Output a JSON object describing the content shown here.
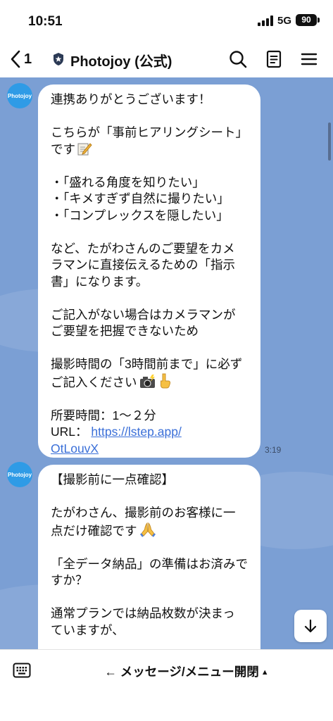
{
  "status_bar": {
    "time": "10:51",
    "network": "5G",
    "battery": "90"
  },
  "nav": {
    "back_count": "1",
    "title": "Photojoy (公式)",
    "icons": [
      "search-icon",
      "note-icon",
      "menu-icon"
    ]
  },
  "messages": [
    {
      "sender": "Photojoy",
      "lines": [
        "連携ありがとうございます！",
        "",
        "こちらが「事前ヒアリングシート」",
        "です",
        "",
        "・「盛れる角度を知りたい」",
        "・「キメすぎず自然に撮りたい」",
        "・「コンプレックスを隠したい」",
        "",
        "など、たがわさんのご要望をカメ",
        "ラマンに直接伝えるための「指示",
        "書」になります。",
        "",
        "ご記入がない場合はカメラマンが",
        "ご要望を把握できないため",
        "",
        "撮影時間の「3時間前まで」に必ず",
        "ご記入ください",
        "",
        "所要時間：1〜２分"
      ],
      "url_label": "URL：",
      "url_line1": "https://lstep.app/",
      "url_line2": "OtLouvX",
      "time": "3:19"
    },
    {
      "sender": "Photojoy",
      "lines": [
        "【撮影前に一点確認】",
        "",
        "たがわさん、撮影前のお客様に一",
        "点だけ確認です",
        "",
        "「全データ納品」の準備はお済みで",
        "すか？",
        "",
        "通常プランでは納品枚数が決まっ",
        "ていますが、"
      ]
    }
  ],
  "bottom_bar": {
    "menu_label": "← メッセージ/メニュー開閉",
    "menu_arrow": "▲"
  }
}
